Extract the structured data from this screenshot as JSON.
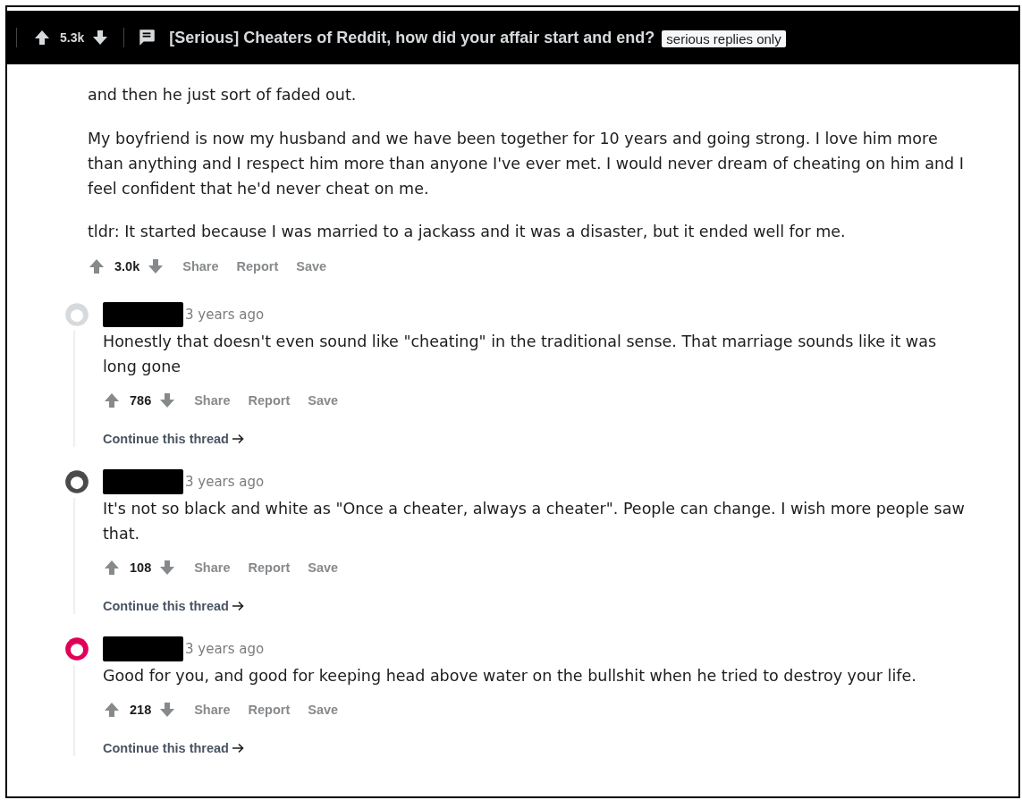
{
  "post_bar": {
    "score": "5.3k",
    "title": "[Serious] Cheaters of Reddit, how did your affair start and end?",
    "flair": "serious replies only"
  },
  "parent_comment": {
    "paragraphs": [
      "and then he just sort of faded out.",
      "My boyfriend is now my husband and we have been together for 10 years and going strong. I love him more than anything and I respect him more than anyone I've ever met. I would never dream of cheating on him and I feel confident that he'd never cheat on me.",
      "tldr: It started because I was married to a jackass and it was a disaster, but it ended well for me."
    ],
    "score": "3.0k",
    "actions": [
      "Share",
      "Report",
      "Save"
    ]
  },
  "replies": [
    {
      "color": "#d7dadc",
      "time": "3 years ago",
      "body": "Honestly that doesn't even sound like \"cheating\" in the traditional sense. That marriage sounds like it was long gone",
      "score": "786",
      "actions": [
        "Share",
        "Report",
        "Save"
      ],
      "continue": "Continue this thread"
    },
    {
      "color": "#4a4a4a",
      "time": "3 years ago",
      "body": "It's not so black and white as \"Once a cheater, always a cheater\". People can change. I wish more people saw that.",
      "score": "108",
      "actions": [
        "Share",
        "Report",
        "Save"
      ],
      "continue": "Continue this thread"
    },
    {
      "color": "#e0005a",
      "time": "3 years ago",
      "body": "Good for you, and good for keeping head above water on the bullshit when he tried to destroy your life.",
      "score": "218",
      "actions": [
        "Share",
        "Report",
        "Save"
      ],
      "continue": "Continue this thread"
    }
  ]
}
